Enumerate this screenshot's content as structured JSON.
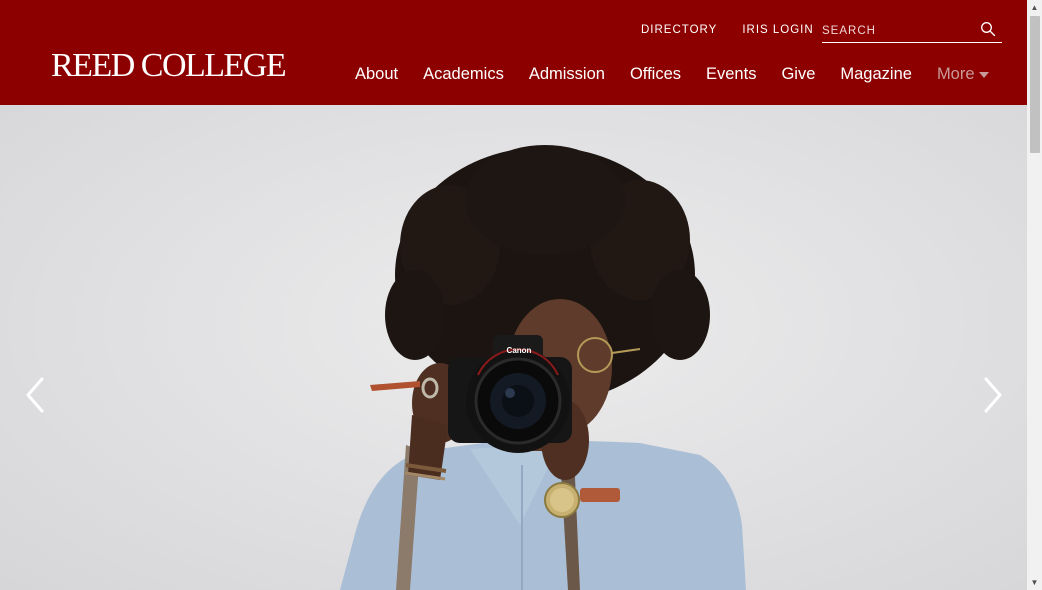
{
  "header": {
    "logo_text": "REED COLLEGE",
    "utility_nav": {
      "directory_label": "DIRECTORY",
      "iris_login_label": "IRIS LOGIN"
    },
    "search": {
      "placeholder": "SEARCH",
      "icon": "search-icon"
    },
    "main_nav": [
      {
        "label": "About"
      },
      {
        "label": "Academics"
      },
      {
        "label": "Admission"
      },
      {
        "label": "Offices"
      },
      {
        "label": "Events"
      },
      {
        "label": "Give"
      },
      {
        "label": "Magazine"
      },
      {
        "label": "More",
        "icon": "caret-down-icon"
      }
    ]
  },
  "hero": {
    "camera_brand": "Canon",
    "prev_icon": "chevron-left-icon",
    "next_icon": "chevron-right-icon"
  },
  "colors": {
    "header_bg": "#8c0000",
    "header_text": "#ffffff",
    "more_text": "#c99a9a",
    "hero_bg": "#e2e2e4"
  }
}
